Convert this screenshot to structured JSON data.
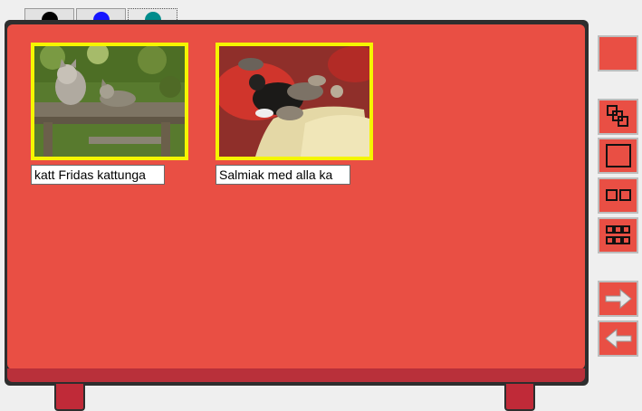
{
  "color_tabs": [
    {
      "name": "black-dot",
      "color": "#000000"
    },
    {
      "name": "blue-dot",
      "color": "#1515ff"
    },
    {
      "name": "teal-dot",
      "color": "#008c8c"
    }
  ],
  "board": {
    "face_color": "#e94f44",
    "photos": [
      {
        "caption": "katt Fridas kattunga"
      },
      {
        "caption": "Salmiak med alla ka"
      }
    ]
  },
  "toolbar": {
    "buttons": [
      {
        "name": "color-swatch-button",
        "icon": "square-swatch"
      },
      {
        "name": "copy-icon-button",
        "icon": "overlapping-squares-icon"
      },
      {
        "name": "single-view-button",
        "icon": "single-square-icon"
      },
      {
        "name": "two-view-button",
        "icon": "two-squares-icon"
      },
      {
        "name": "grid-view-button",
        "icon": "grid-icon"
      },
      {
        "name": "next-button",
        "icon": "arrow-right-icon"
      },
      {
        "name": "previous-button",
        "icon": "arrow-left-icon"
      }
    ]
  }
}
